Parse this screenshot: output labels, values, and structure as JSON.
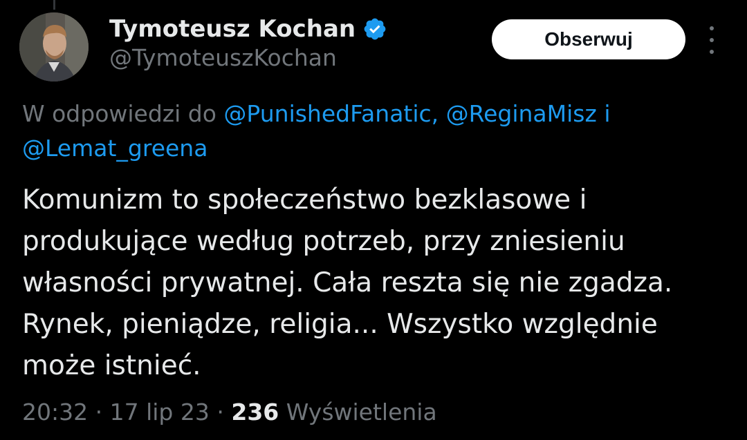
{
  "author": {
    "display_name": "Tymoteusz Kochan",
    "handle": "@TymoteuszKochan",
    "verified_icon": "verified-badge-icon"
  },
  "actions": {
    "follow_label": "Obserwuj",
    "more_icon": "more-vertical-icon"
  },
  "reply": {
    "prefix": "W odpowiedzi do",
    "mention_1": "@PunishedFanatic,",
    "mention_2": "@ReginaMisz",
    "conjunction": "i",
    "mention_3": "@Lemat_greena"
  },
  "tweet": {
    "text": "Komunizm to społeczeństwo bezklasowe i\nprodukujące według potrzeb, przy zniesieniu\nwłasności prywatnej. Cała reszta się nie zgadza.\nRynek, pieniądze, religia... Wszystko względnie\nmoże istnieć."
  },
  "meta": {
    "time": "20:32",
    "separator_1": "·",
    "date": "17 lip 23",
    "separator_2": "·",
    "views_count": "236",
    "views_label": "Wyświetlenia"
  },
  "colors": {
    "background": "#000000",
    "text_primary": "#e7e9ea",
    "text_secondary": "#71767b",
    "accent": "#1d9bf0"
  }
}
